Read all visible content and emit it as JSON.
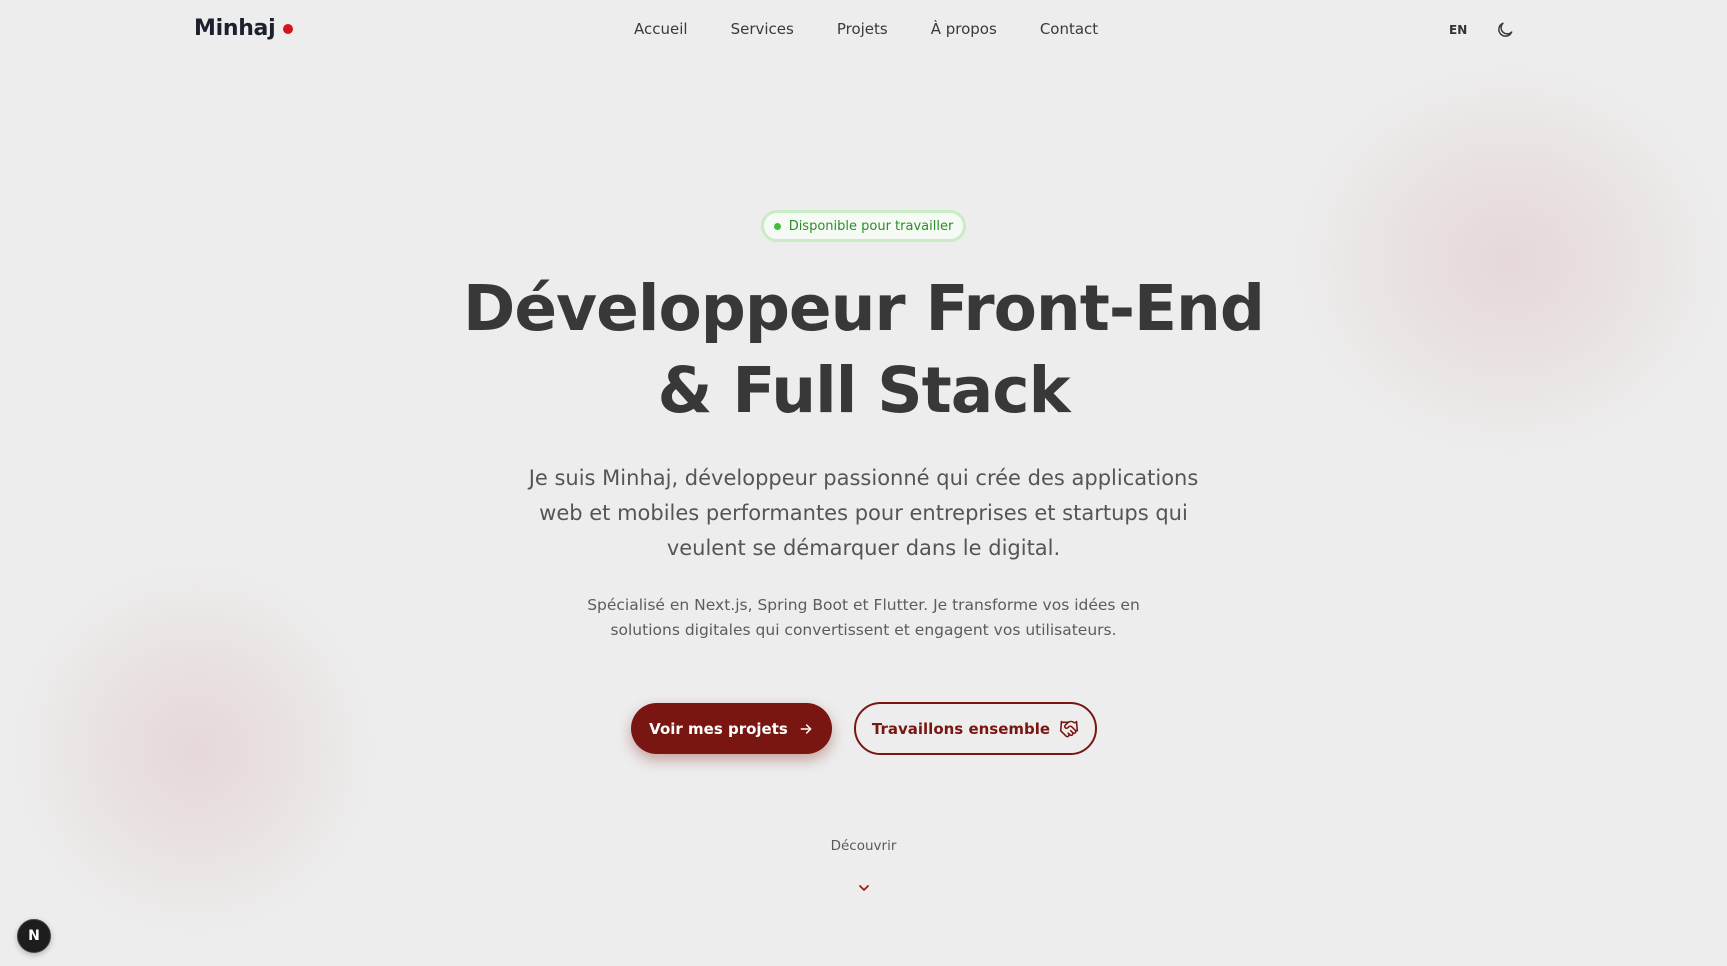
{
  "header": {
    "logo": "Minhaj",
    "nav": [
      "Accueil",
      "Services",
      "Projets",
      "À propos",
      "Contact"
    ],
    "lang_toggle": "EN",
    "theme_icon": "moon-icon"
  },
  "hero": {
    "badge": "Disponible pour travailler",
    "title_line1": "Développeur Front-End",
    "title_line2": "& Full Stack",
    "lead": "Je suis Minhaj, développeur passionné qui crée des applications web et mobiles performantes pour entreprises et startups qui veulent se démarquer dans le digital.",
    "sub": "Spécialisé en Next.js, Spring Boot et Flutter. Je transforme vos idées en solutions digitales qui convertissent et engagent vos utilisateurs.",
    "primary_cta": "Voir mes projets",
    "primary_cta_icon": "arrow-right-icon",
    "secondary_cta": "Travaillons ensemble",
    "secondary_cta_icon": "handshake-icon",
    "discover": "Découvrir",
    "discover_icon": "chevron-down-icon"
  },
  "dev_badge": "N",
  "colors": {
    "accent": "#7a1612",
    "logo_dot": "#d2141f",
    "status_green": "#3fbf3a",
    "background": "#ededed"
  }
}
